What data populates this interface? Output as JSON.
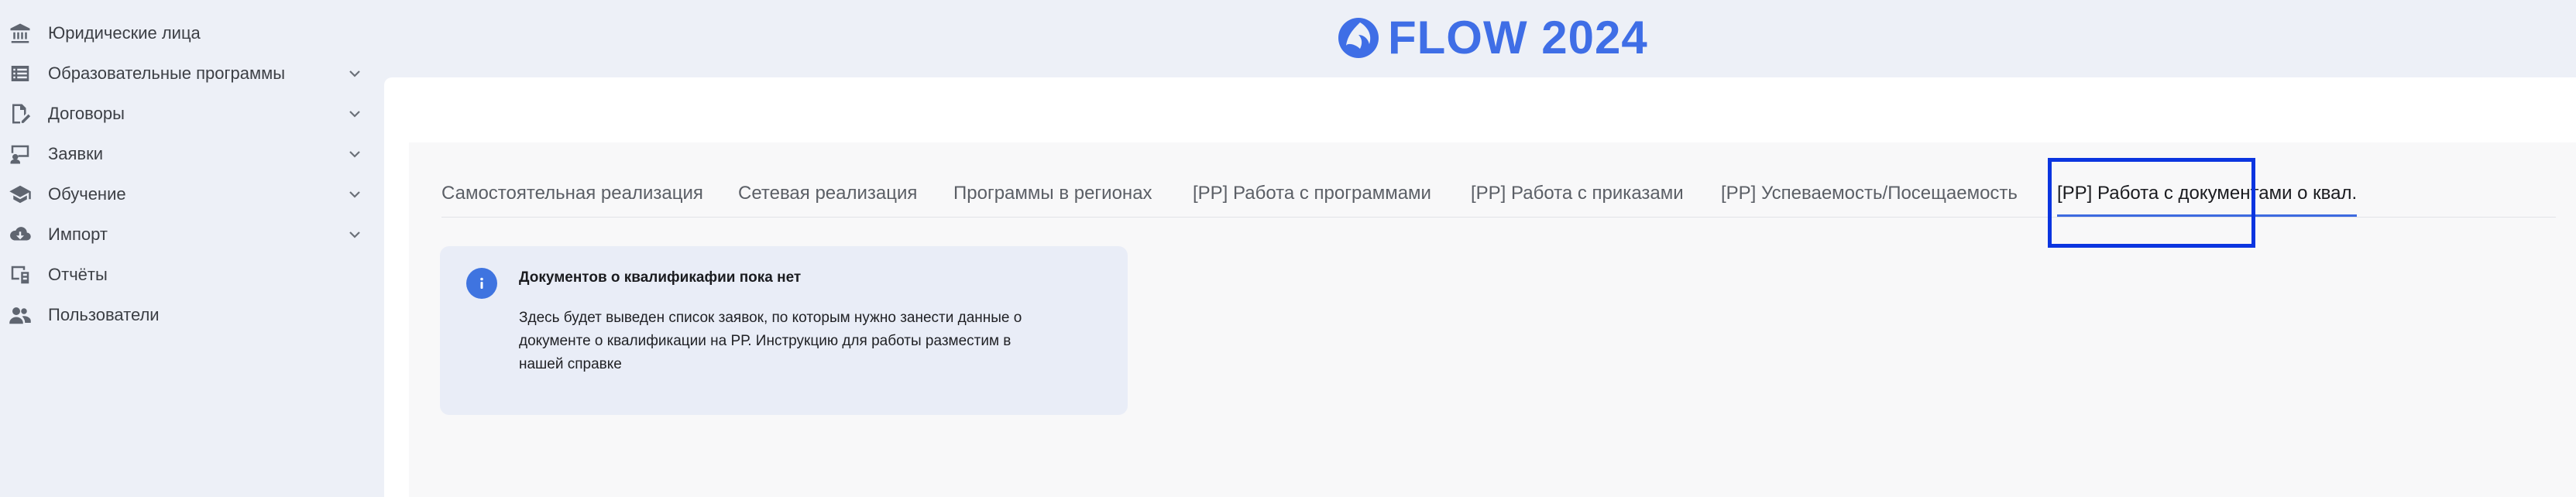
{
  "sidebar": {
    "items": [
      {
        "label": "Юридические лица",
        "icon": "bank-icon",
        "expandable": false
      },
      {
        "label": "Образовательные программы",
        "icon": "list-icon",
        "expandable": true
      },
      {
        "label": "Договоры",
        "icon": "contract-edit-icon",
        "expandable": true
      },
      {
        "label": "Заявки",
        "icon": "teacher-icon",
        "expandable": true
      },
      {
        "label": "Обучение",
        "icon": "graduation-cap-icon",
        "expandable": true
      },
      {
        "label": "Импорт",
        "icon": "cloud-download-icon",
        "expandable": true
      },
      {
        "label": "Отчёты",
        "icon": "report-icon",
        "expandable": false
      },
      {
        "label": "Пользователи",
        "icon": "users-icon",
        "expandable": false
      }
    ]
  },
  "header": {
    "logo_text": "FLOW 2024",
    "logo_color": "#3f6ee6"
  },
  "tabs": [
    {
      "label": "Самостоятельная реализация",
      "active": false
    },
    {
      "label": "Сетевая реализация",
      "active": false
    },
    {
      "label": "Программы в регионах",
      "active": false
    },
    {
      "label": "[РР] Работа с программами",
      "active": false
    },
    {
      "label": "[РР] Работа с приказами",
      "active": false
    },
    {
      "label": "[РР] Успеваемость/Посещаемость",
      "active": false
    },
    {
      "label": "[РР] Работа с документами о квал.",
      "active": true
    }
  ],
  "notice": {
    "title": "Документов о квалификафии пока нет",
    "lines": [
      "Здесь будет выведен список заявок, по которым нужно занести данные о",
      "документе о квалификации на РР. Инструкцию для работы разместим в",
      "нашей справке"
    ]
  },
  "colors": {
    "accent": "#3d6ae0",
    "highlight_box": "#0b35e0",
    "info_bg": "#e9edf7",
    "info_icon": "#3f74e0"
  }
}
